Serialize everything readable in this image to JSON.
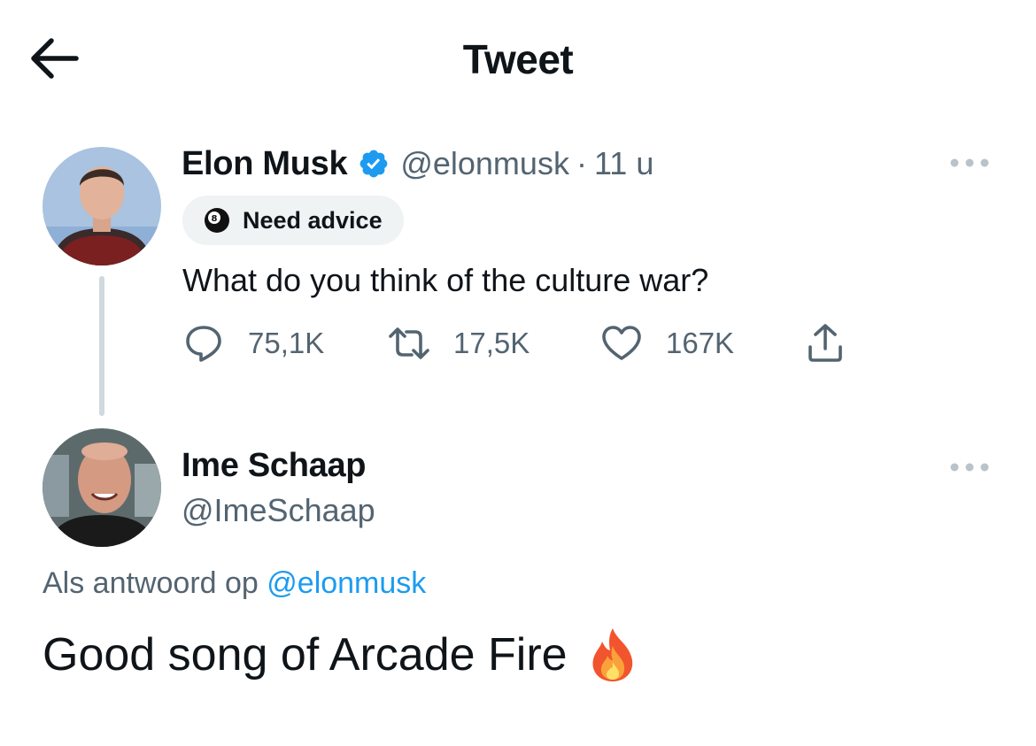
{
  "header": {
    "title": "Tweet",
    "back_icon": "arrow-left-icon"
  },
  "original_tweet": {
    "author_name": "Elon Musk",
    "verified": true,
    "handle": "@elonmusk",
    "separator": "·",
    "time": "11 u",
    "badge_label": "Need advice",
    "badge_icon": "8-ball-icon",
    "text": "What do you think of the culture war?",
    "stats": {
      "replies": "75,1K",
      "retweets": "17,5K",
      "likes": "167K"
    }
  },
  "reply_tweet": {
    "author_name": "Ime Schaap",
    "handle": "@ImeSchaap",
    "replying_prefix": "Als antwoord op",
    "replying_to": "@elonmusk",
    "text": "Good song of Arcade Fire",
    "emoji": "fire-emoji"
  },
  "colors": {
    "accent": "#1d9bf0",
    "muted": "#536471",
    "text": "#0f1419",
    "badge_bg": "#eff3f4"
  }
}
